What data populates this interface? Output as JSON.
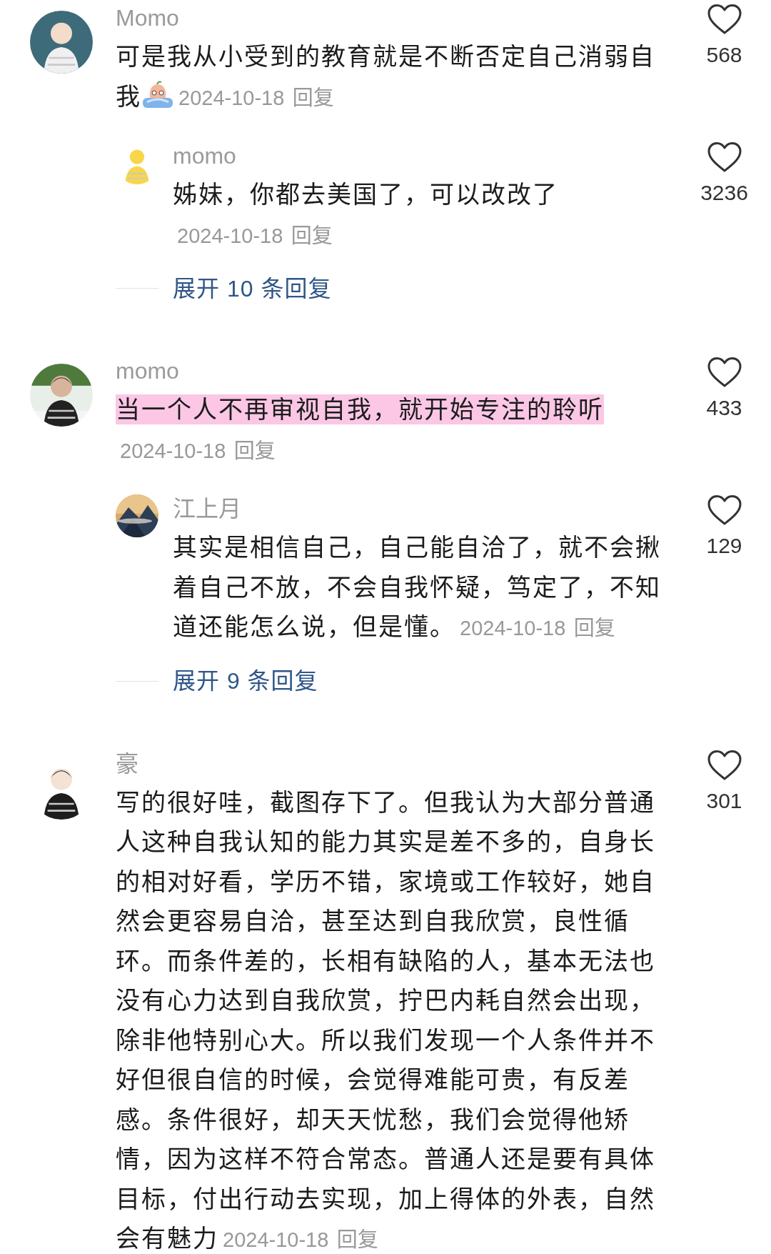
{
  "comments": [
    {
      "user": "Momo",
      "text": "可是我从小受到的教育就是不断否定自己消弱自我",
      "emoji": true,
      "highlighted": false,
      "date": "2024-10-18",
      "reply_label": "回复",
      "likes": "568",
      "replies": [
        {
          "user": "momo",
          "text": "姊妹，你都去美国了，可以改改了",
          "date": "2024-10-18",
          "reply_label": "回复",
          "likes": "3236"
        }
      ],
      "expand": "展开 10 条回复"
    },
    {
      "user": "momo",
      "text": "当一个人不再审视自我，就开始专注的聆听",
      "emoji": false,
      "highlighted": true,
      "date": "2024-10-18",
      "reply_label": "回复",
      "likes": "433",
      "replies": [
        {
          "user": "江上月",
          "text": "其实是相信自己，自己能自洽了，就不会揪着自己不放，不会自我怀疑，笃定了，不知道还能怎么说，但是懂。",
          "date": "2024-10-18",
          "reply_label": "回复",
          "likes": "129"
        }
      ],
      "expand": "展开 9 条回复"
    },
    {
      "user": "豪",
      "text": "写的很好哇，截图存下了。但我认为大部分普通人这种自我认知的能力其实是差不多的，自身长的相对好看，学历不错，家境或工作较好，她自然会更容易自洽，甚至达到自我欣赏，良性循环。而条件差的，长相有缺陷的人，基本无法也没有心力达到自我欣赏，拧巴内耗自然会出现，除非他特别心大。所以我们发现一个人条件并不好但很自信的时候，会觉得难能可贵，有反差感。条件很好，却天天忧愁，我们会觉得他矫情，因为这样不符合常态。普通人还是要有具体目标，付出行动去实现，加上得体的外表，自然会有魅力",
      "emoji": false,
      "highlighted": false,
      "date": "2024-10-18",
      "reply_label": "回复",
      "likes": "301"
    }
  ]
}
